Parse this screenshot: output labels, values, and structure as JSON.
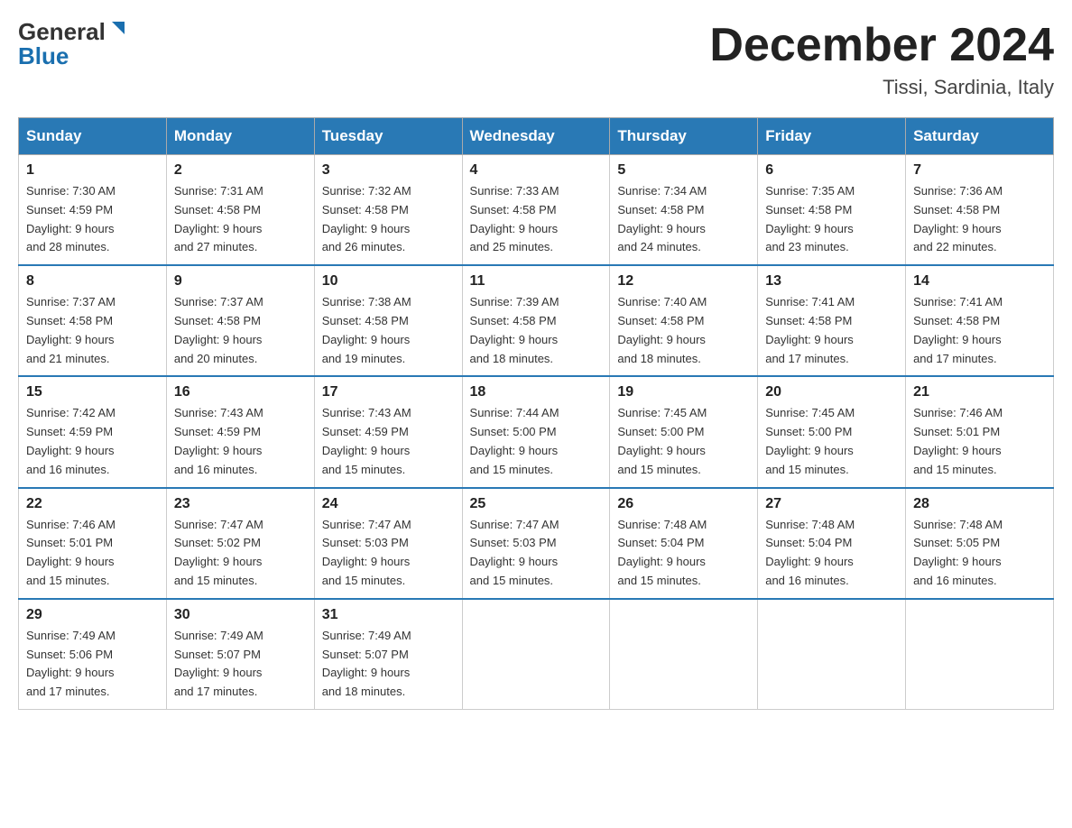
{
  "header": {
    "logo_general": "General",
    "logo_blue": "Blue",
    "month_title": "December 2024",
    "location": "Tissi, Sardinia, Italy"
  },
  "days_of_week": [
    "Sunday",
    "Monday",
    "Tuesday",
    "Wednesday",
    "Thursday",
    "Friday",
    "Saturday"
  ],
  "weeks": [
    [
      {
        "num": "1",
        "sunrise": "7:30 AM",
        "sunset": "4:59 PM",
        "daylight": "9 hours and 28 minutes."
      },
      {
        "num": "2",
        "sunrise": "7:31 AM",
        "sunset": "4:58 PM",
        "daylight": "9 hours and 27 minutes."
      },
      {
        "num": "3",
        "sunrise": "7:32 AM",
        "sunset": "4:58 PM",
        "daylight": "9 hours and 26 minutes."
      },
      {
        "num": "4",
        "sunrise": "7:33 AM",
        "sunset": "4:58 PM",
        "daylight": "9 hours and 25 minutes."
      },
      {
        "num": "5",
        "sunrise": "7:34 AM",
        "sunset": "4:58 PM",
        "daylight": "9 hours and 24 minutes."
      },
      {
        "num": "6",
        "sunrise": "7:35 AM",
        "sunset": "4:58 PM",
        "daylight": "9 hours and 23 minutes."
      },
      {
        "num": "7",
        "sunrise": "7:36 AM",
        "sunset": "4:58 PM",
        "daylight": "9 hours and 22 minutes."
      }
    ],
    [
      {
        "num": "8",
        "sunrise": "7:37 AM",
        "sunset": "4:58 PM",
        "daylight": "9 hours and 21 minutes."
      },
      {
        "num": "9",
        "sunrise": "7:37 AM",
        "sunset": "4:58 PM",
        "daylight": "9 hours and 20 minutes."
      },
      {
        "num": "10",
        "sunrise": "7:38 AM",
        "sunset": "4:58 PM",
        "daylight": "9 hours and 19 minutes."
      },
      {
        "num": "11",
        "sunrise": "7:39 AM",
        "sunset": "4:58 PM",
        "daylight": "9 hours and 18 minutes."
      },
      {
        "num": "12",
        "sunrise": "7:40 AM",
        "sunset": "4:58 PM",
        "daylight": "9 hours and 18 minutes."
      },
      {
        "num": "13",
        "sunrise": "7:41 AM",
        "sunset": "4:58 PM",
        "daylight": "9 hours and 17 minutes."
      },
      {
        "num": "14",
        "sunrise": "7:41 AM",
        "sunset": "4:58 PM",
        "daylight": "9 hours and 17 minutes."
      }
    ],
    [
      {
        "num": "15",
        "sunrise": "7:42 AM",
        "sunset": "4:59 PM",
        "daylight": "9 hours and 16 minutes."
      },
      {
        "num": "16",
        "sunrise": "7:43 AM",
        "sunset": "4:59 PM",
        "daylight": "9 hours and 16 minutes."
      },
      {
        "num": "17",
        "sunrise": "7:43 AM",
        "sunset": "4:59 PM",
        "daylight": "9 hours and 15 minutes."
      },
      {
        "num": "18",
        "sunrise": "7:44 AM",
        "sunset": "5:00 PM",
        "daylight": "9 hours and 15 minutes."
      },
      {
        "num": "19",
        "sunrise": "7:45 AM",
        "sunset": "5:00 PM",
        "daylight": "9 hours and 15 minutes."
      },
      {
        "num": "20",
        "sunrise": "7:45 AM",
        "sunset": "5:00 PM",
        "daylight": "9 hours and 15 minutes."
      },
      {
        "num": "21",
        "sunrise": "7:46 AM",
        "sunset": "5:01 PM",
        "daylight": "9 hours and 15 minutes."
      }
    ],
    [
      {
        "num": "22",
        "sunrise": "7:46 AM",
        "sunset": "5:01 PM",
        "daylight": "9 hours and 15 minutes."
      },
      {
        "num": "23",
        "sunrise": "7:47 AM",
        "sunset": "5:02 PM",
        "daylight": "9 hours and 15 minutes."
      },
      {
        "num": "24",
        "sunrise": "7:47 AM",
        "sunset": "5:03 PM",
        "daylight": "9 hours and 15 minutes."
      },
      {
        "num": "25",
        "sunrise": "7:47 AM",
        "sunset": "5:03 PM",
        "daylight": "9 hours and 15 minutes."
      },
      {
        "num": "26",
        "sunrise": "7:48 AM",
        "sunset": "5:04 PM",
        "daylight": "9 hours and 15 minutes."
      },
      {
        "num": "27",
        "sunrise": "7:48 AM",
        "sunset": "5:04 PM",
        "daylight": "9 hours and 16 minutes."
      },
      {
        "num": "28",
        "sunrise": "7:48 AM",
        "sunset": "5:05 PM",
        "daylight": "9 hours and 16 minutes."
      }
    ],
    [
      {
        "num": "29",
        "sunrise": "7:49 AM",
        "sunset": "5:06 PM",
        "daylight": "9 hours and 17 minutes."
      },
      {
        "num": "30",
        "sunrise": "7:49 AM",
        "sunset": "5:07 PM",
        "daylight": "9 hours and 17 minutes."
      },
      {
        "num": "31",
        "sunrise": "7:49 AM",
        "sunset": "5:07 PM",
        "daylight": "9 hours and 18 minutes."
      },
      null,
      null,
      null,
      null
    ]
  ],
  "labels": {
    "sunrise": "Sunrise:",
    "sunset": "Sunset:",
    "daylight": "Daylight:"
  }
}
